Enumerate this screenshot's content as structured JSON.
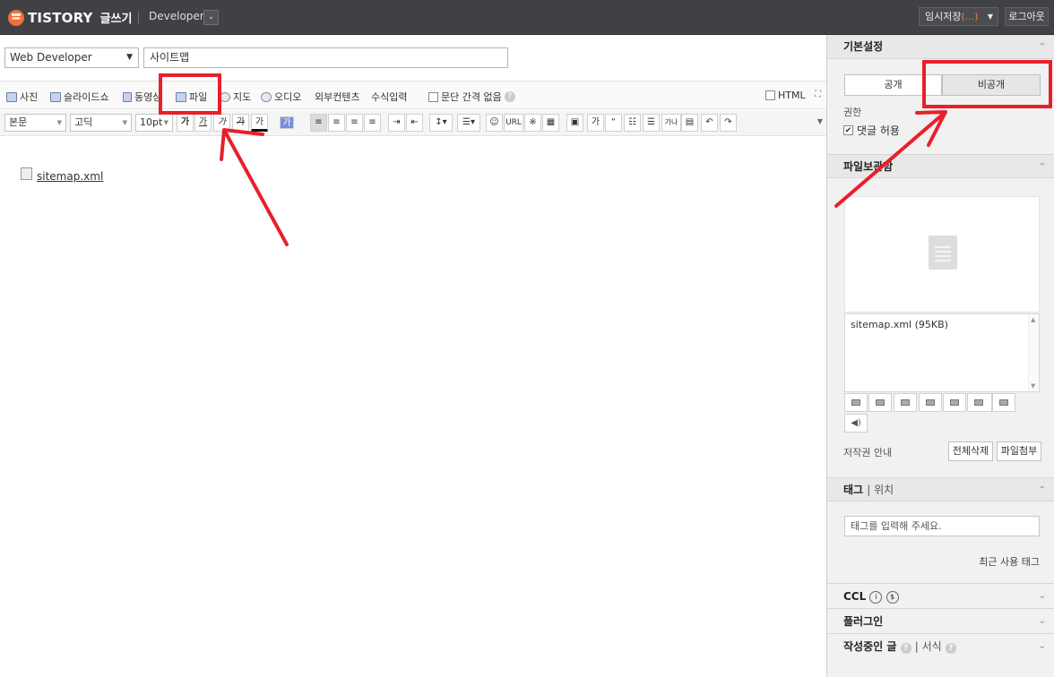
{
  "topbar": {
    "brand": "TISTORY",
    "mode": "글쓰기",
    "blog_name": "Developer",
    "save_label": "임시저장",
    "save_count": "(...)",
    "logout_label": "로그아웃"
  },
  "editor": {
    "category": "Web Developer",
    "title": "사이트맵",
    "toolbar1": {
      "photo": "사진",
      "slideshow": "슬라이드쇼",
      "video": "동영상",
      "file": "파일",
      "map": "지도",
      "audio": "오디오",
      "external": "외부컨텐츠",
      "formula": "수식입력",
      "no_spacing": "문단 간격 없음",
      "html": "HTML"
    },
    "toolbar2": {
      "style": "본문",
      "font": "고딕",
      "size": "10pt",
      "bold": "가",
      "italic": "가",
      "underline": "가",
      "strike": "가",
      "color": "가",
      "bgcolor": "가",
      "url": "URL",
      "asterisk": "※",
      "box": "가",
      "quote": "“",
      "more": "가나"
    },
    "attached_file": "sitemap.xml"
  },
  "sidebar": {
    "basic": {
      "heading": "기본설정",
      "public": "공개",
      "private": "비공개",
      "permission": "권한",
      "allow_comment": "댓글 허용"
    },
    "files": {
      "heading": "파일보관함",
      "items": [
        "sitemap.xml (95KB)"
      ],
      "copyright": "저작권 안내",
      "delete_all": "전체삭제",
      "attach": "파일첨부"
    },
    "tags": {
      "heading": "태그",
      "location": "위치",
      "placeholder": "태그를 입력해 주세요.",
      "recent": "최근 사용 태그"
    },
    "ccl": "CCL",
    "plugin": "플러그인",
    "drafts": "작성중인 글",
    "format": "서식"
  },
  "colors": {
    "topbar": "#3f4144",
    "brand_accent": "#f16f3a",
    "annotation_red": "#e8202a"
  }
}
